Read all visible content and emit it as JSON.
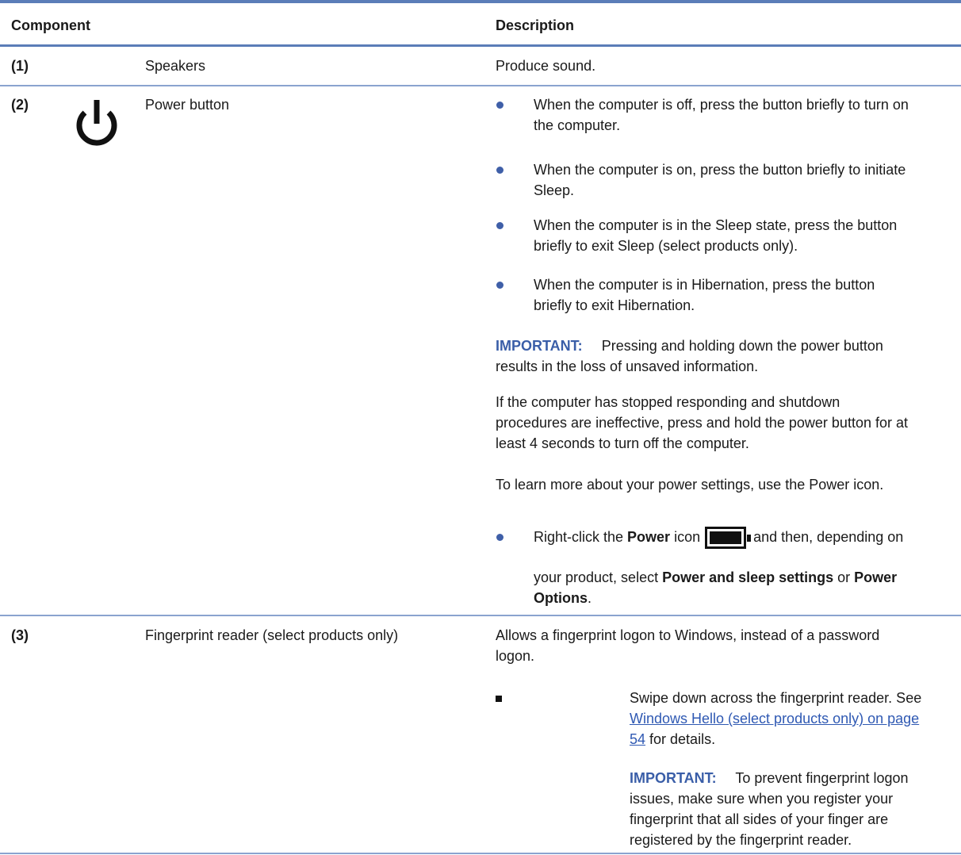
{
  "table": {
    "headers": {
      "component": "Component",
      "description": "Description"
    },
    "rows": [
      {
        "number": "(1)",
        "name": "Speakers",
        "description": "Produce sound."
      },
      {
        "number": "(2)",
        "icon": "power-icon",
        "name": "Power button",
        "bullets": [
          "When the computer is off, press the button briefly to turn on",
          "the computer.",
          "When the computer is on, press the button briefly to initiate",
          "Sleep.",
          "When the computer is in the Sleep state, press the button",
          "briefly to exit Sleep (select products only).",
          "When the computer is in Hibernation, press the button",
          "briefly to exit Hibernation."
        ],
        "important_label": "IMPORTANT:",
        "important_text_1": "Pressing and holding down the power button",
        "important_text_2": "results in the loss of unsaved information.",
        "para_1": "If the computer has stopped responding and shutdown",
        "para_2": "procedures are ineffective, press and hold the power button for at",
        "para_3": "least 4 seconds to turn off the computer.",
        "para_4": "To learn more about your power settings, use the Power icon.",
        "rc_prefix": "Right-click the ",
        "rc_power": "Power",
        "rc_icon_word": " icon",
        "rc_suffix": " and then, depending on",
        "rc2_prefix": "your product, select ",
        "rc2_bold1": "Power and sleep settings",
        "rc2_or": " or ",
        "rc2_bold2": "Power",
        "rc3_bold": "Options",
        "rc3_end": "."
      },
      {
        "number": "(3)",
        "name": "Fingerprint reader (select products only)",
        "desc_1": "Allows a fingerprint logon to Windows, instead of a password",
        "desc_2": "logon.",
        "swipe_1": "Swipe down across the fingerprint reader. See",
        "link_1": "Windows Hello (select products only) on page",
        "link_2": "54",
        "swipe_end": " for details.",
        "important_label": "IMPORTANT:",
        "imp_1": "To prevent fingerprint logon",
        "imp_2": "issues, make sure when you register your",
        "imp_3": "fingerprint that all sides of your finger are",
        "imp_4": "registered by the fingerprint reader."
      }
    ]
  },
  "colors": {
    "rule": "#5b7db8",
    "accent": "#3a5ea8",
    "link": "#2f59b3"
  }
}
